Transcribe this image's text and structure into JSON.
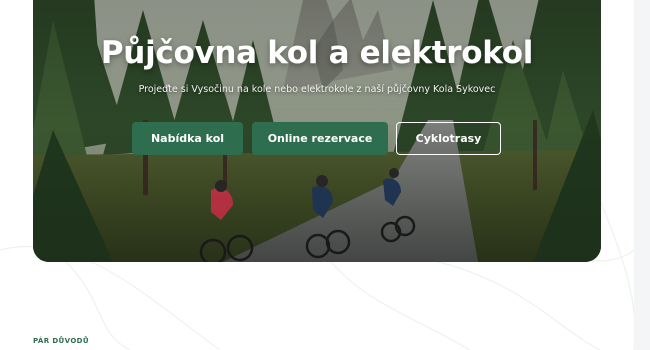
{
  "hero": {
    "title": "Půjčovna kol a elektrokol",
    "subtitle": "Projeďte si Vysočinu na kole nebo elektrokole z naší půjčovny Kola Sykovec",
    "image_alt": "Cyclists riding a forest road",
    "buttons": [
      {
        "label": "Nabídka kol",
        "style": "filled"
      },
      {
        "label": "Online rezervace",
        "style": "filled"
      },
      {
        "label": "Cyklotrasy",
        "style": "outline"
      }
    ]
  },
  "section": {
    "label": "PÁR DŮVODŮ"
  },
  "colors": {
    "brand_green": "#2e6e4e",
    "text_white": "#ffffff"
  }
}
